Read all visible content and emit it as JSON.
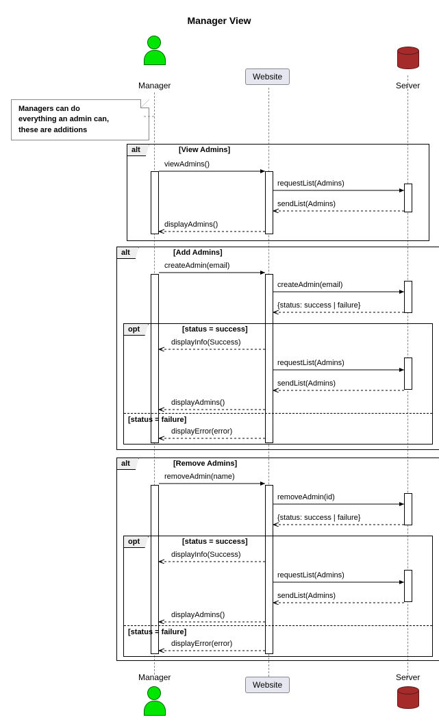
{
  "title": "Manager View",
  "participants": {
    "manager": "Manager",
    "website": "Website",
    "server": "Server"
  },
  "note": {
    "line1": "Managers can do",
    "line2": "everything an admin can,",
    "line3": "these are additions"
  },
  "frames": {
    "view": {
      "op": "alt",
      "cond": "[View Admins]"
    },
    "add": {
      "op": "alt",
      "cond": "[Add Admins]"
    },
    "add_opt": {
      "op": "opt",
      "cond": "[status = success]",
      "else": "[status = failure]"
    },
    "remove": {
      "op": "alt",
      "cond": "[Remove Admins]"
    },
    "remove_opt": {
      "op": "opt",
      "cond": "[status = success]",
      "else": "[status = failure]"
    }
  },
  "messages": {
    "m1": "viewAdmins()",
    "m2": "requestList(Admins)",
    "m3": "sendList(Admins)",
    "m4": "displayAdmins()",
    "m5": "createAdmin(email)",
    "m6": "createAdmin(email)",
    "m7": "{status: success | failure}",
    "m8": "displayInfo(Success)",
    "m9": "requestList(Admins)",
    "m10": "sendList(Admins)",
    "m11": "displayAdmins()",
    "m12": "displayError(error)",
    "m13": "removeAdmin(name)",
    "m14": "removeAdmin(id)",
    "m15": "{status: success | failure}",
    "m16": "displayInfo(Success)",
    "m17": "requestList(Admins)",
    "m18": "sendList(Admins)",
    "m19": "displayAdmins()",
    "m20": "displayError(error)"
  },
  "chart_data": {
    "type": "sequence-diagram",
    "title": "Manager View",
    "participants": [
      {
        "name": "Manager",
        "type": "actor"
      },
      {
        "name": "Website",
        "type": "boundary"
      },
      {
        "name": "Server",
        "type": "database"
      }
    ],
    "note": {
      "attached_to": "Manager",
      "text": "Managers can do everything an admin can, these are additions"
    },
    "fragments": [
      {
        "operator": "alt",
        "guard": "View Admins",
        "messages": [
          {
            "from": "Manager",
            "to": "Website",
            "label": "viewAdmins()",
            "kind": "sync"
          },
          {
            "from": "Website",
            "to": "Server",
            "label": "requestList(Admins)",
            "kind": "sync"
          },
          {
            "from": "Server",
            "to": "Website",
            "label": "sendList(Admins)",
            "kind": "return"
          },
          {
            "from": "Website",
            "to": "Manager",
            "label": "displayAdmins()",
            "kind": "return"
          }
        ]
      },
      {
        "operator": "alt",
        "guard": "Add Admins",
        "messages": [
          {
            "from": "Manager",
            "to": "Website",
            "label": "createAdmin(email)",
            "kind": "sync"
          },
          {
            "from": "Website",
            "to": "Server",
            "label": "createAdmin(email)",
            "kind": "sync"
          },
          {
            "from": "Server",
            "to": "Website",
            "label": "{status: success | failure}",
            "kind": "return"
          }
        ],
        "nested": [
          {
            "operator": "opt",
            "guard": "status = success",
            "messages": [
              {
                "from": "Website",
                "to": "Manager",
                "label": "displayInfo(Success)",
                "kind": "return"
              },
              {
                "from": "Website",
                "to": "Server",
                "label": "requestList(Admins)",
                "kind": "sync"
              },
              {
                "from": "Server",
                "to": "Website",
                "label": "sendList(Admins)",
                "kind": "return"
              },
              {
                "from": "Website",
                "to": "Manager",
                "label": "displayAdmins()",
                "kind": "return"
              }
            ],
            "else": {
              "guard": "status = failure",
              "messages": [
                {
                  "from": "Website",
                  "to": "Manager",
                  "label": "displayError(error)",
                  "kind": "return"
                }
              ]
            }
          }
        ]
      },
      {
        "operator": "alt",
        "guard": "Remove Admins",
        "messages": [
          {
            "from": "Manager",
            "to": "Website",
            "label": "removeAdmin(name)",
            "kind": "sync"
          },
          {
            "from": "Website",
            "to": "Server",
            "label": "removeAdmin(id)",
            "kind": "sync"
          },
          {
            "from": "Server",
            "to": "Website",
            "label": "{status: success | failure}",
            "kind": "return"
          }
        ],
        "nested": [
          {
            "operator": "opt",
            "guard": "status = success",
            "messages": [
              {
                "from": "Website",
                "to": "Manager",
                "label": "displayInfo(Success)",
                "kind": "return"
              },
              {
                "from": "Website",
                "to": "Server",
                "label": "requestList(Admins)",
                "kind": "sync"
              },
              {
                "from": "Server",
                "to": "Website",
                "label": "sendList(Admins)",
                "kind": "return"
              },
              {
                "from": "Website",
                "to": "Manager",
                "label": "displayAdmins()",
                "kind": "return"
              }
            ],
            "else": {
              "guard": "status = failure",
              "messages": [
                {
                  "from": "Website",
                  "to": "Manager",
                  "label": "displayError(error)",
                  "kind": "return"
                }
              ]
            }
          }
        ]
      }
    ]
  }
}
